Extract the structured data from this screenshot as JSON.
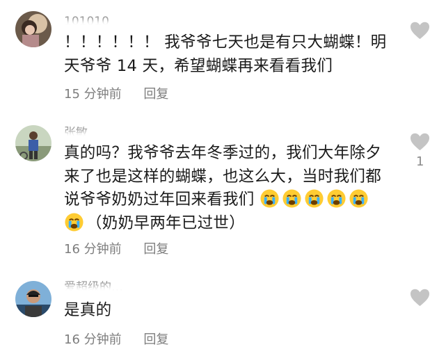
{
  "comments": [
    {
      "username": "101010",
      "text": "！！！！！！ 我爷爷七天也是有只大蝴蝶！明天爷爷 14 天，希望蝴蝶再来看看我们",
      "time": "15 分钟前",
      "reply_label": "回复",
      "like_count": "",
      "emojis": []
    },
    {
      "username": "张敏",
      "text": "真的吗？我爷爷去年冬季过的，我们大年除夕来了也是这样的蝴蝶，也这么大，当时我们都说爷爷奶奶过年回来看我们",
      "text_after_emojis": "（奶奶早两年已过世）",
      "time": "16 分钟前",
      "reply_label": "回复",
      "like_count": "1",
      "emojis": [
        "crying-face",
        "crying-face",
        "crying-face",
        "crying-face",
        "crying-face",
        "crying-face"
      ]
    },
    {
      "username": "爱超级的…",
      "text": "是真的",
      "time": "16 分钟前",
      "reply_label": "回复",
      "like_count": "",
      "emojis": []
    }
  ],
  "icons": {
    "like": "heart-outline-icon",
    "emoji": "crying-face"
  },
  "colors": {
    "text": "#1a1a1a",
    "meta": "#7d7d7d",
    "heart": "#c4c4c4"
  }
}
